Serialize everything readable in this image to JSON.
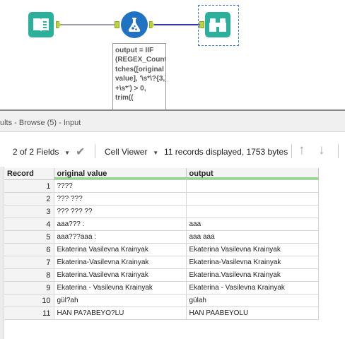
{
  "workflow": {
    "tools": [
      {
        "name": "input-data-tool",
        "icon": "book-icon"
      },
      {
        "name": "formula-tool",
        "icon": "flask-icon"
      },
      {
        "name": "browse-tool",
        "icon": "binoculars-icon"
      }
    ],
    "annotation": "output = IIF\n(REGEX_CountMa\ntches([original\nvalue], '\\s*\\?{3,}\n+\\s*') > 0,\ntrim((",
    "colors": {
      "tool_teal": "#2bb19b",
      "formula_blue": "#1f73c2",
      "connection_selected": "#2d3aa8",
      "anchor": "#bcd23a"
    }
  },
  "results": {
    "title": "ults - Browse (5) - Input",
    "fields_label": "2 of 2 Fields",
    "cell_viewer_label": "Cell Viewer",
    "records_info": "11 records displayed, 1753 bytes",
    "columns": [
      "Record",
      "original value",
      "output"
    ],
    "rows": [
      {
        "record": "1",
        "original": "????",
        "output": ""
      },
      {
        "record": "2",
        "original": "??? ???",
        "output": ""
      },
      {
        "record": "3",
        "original": "??? ??? ??",
        "output": ""
      },
      {
        "record": "4",
        "original": "aaa??? :",
        "output": "aaa"
      },
      {
        "record": "5",
        "original": "aaa???aaa :",
        "output": "aaa aaa"
      },
      {
        "record": "6",
        "original": "Ekaterina Vasilevna Krainyak",
        "output": "Ekaterina Vasilevna Krainyak"
      },
      {
        "record": "7",
        "original": "Ekaterina-Vasilevna Krainyak",
        "output": "Ekaterina-Vasilevna Krainyak"
      },
      {
        "record": "8",
        "original": "Ekaterina.Vasilevna Krainyak",
        "output": "Ekaterina.Vasilevna Krainyak"
      },
      {
        "record": "9",
        "original": "Ekaterina - Vasilevna Krainyak",
        "output": "Ekaterina - Vasilevna Krainyak"
      },
      {
        "record": "10",
        "original": "gül?ah",
        "output": "gülah"
      },
      {
        "record": "11",
        "original": "HAN PA?ABEYO?LU",
        "output": "HAN PAABEYOLU"
      }
    ]
  }
}
